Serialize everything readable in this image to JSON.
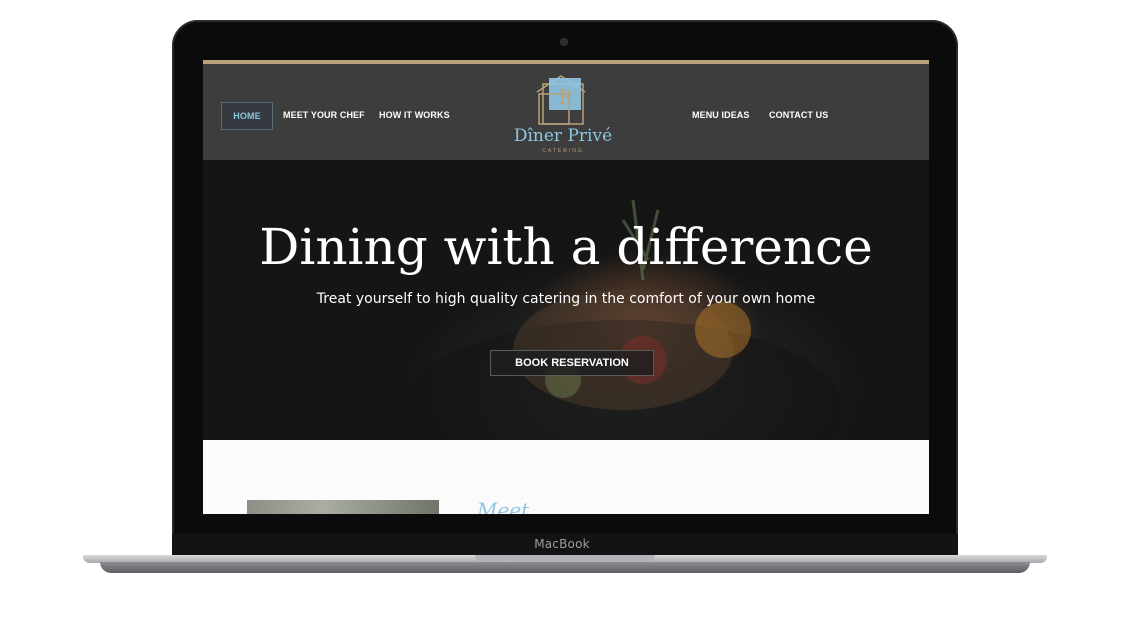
{
  "device": {
    "brand_label": "MacBook"
  },
  "nav": {
    "left_items": [
      "HOME",
      "MEET YOUR CHEF",
      "HOW IT WORKS"
    ],
    "right_items": [
      "MENU IDEAS",
      "CONTACT US"
    ],
    "active": "HOME"
  },
  "logo": {
    "monogram": "P",
    "name": "Dîner Privé",
    "tagline": "CATERING"
  },
  "hero": {
    "title": "Dining with a difference",
    "subtitle": "Treat yourself to high quality catering in the comfort of your own home",
    "button_label": "BOOK RESERVATION"
  },
  "about": {
    "heading_partial": "Meet"
  },
  "colors": {
    "accent_blue": "#8fc7e3",
    "gold": "#b9a27a",
    "nav_bg": "#3d3d3d"
  }
}
